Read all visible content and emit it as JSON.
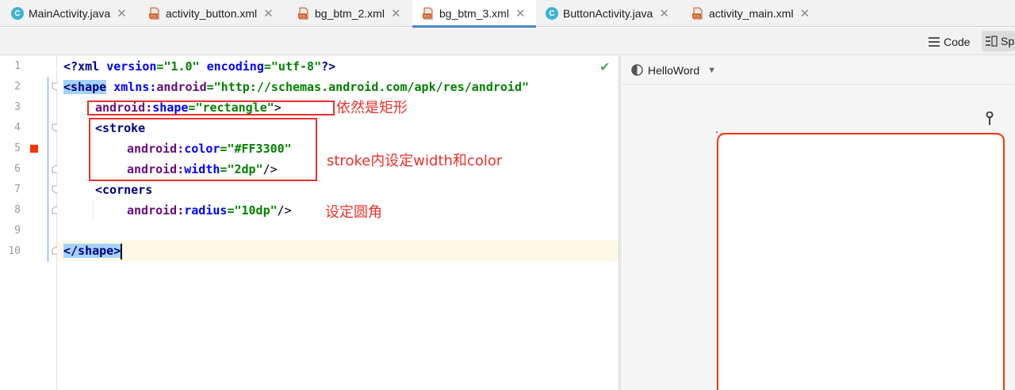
{
  "tabs": [
    {
      "label": "MainActivity.java",
      "type": "java",
      "active": false
    },
    {
      "label": "activity_button.xml",
      "type": "xml",
      "active": false
    },
    {
      "label": "bg_btm_2.xml",
      "type": "xml",
      "active": false
    },
    {
      "label": "bg_btm_3.xml",
      "type": "xml",
      "active": true
    },
    {
      "label": "ButtonActivity.java",
      "type": "java",
      "active": false
    },
    {
      "label": "activity_main.xml",
      "type": "xml",
      "active": false
    }
  ],
  "toolbar": {
    "code_label": "Code",
    "split_label": "Sp"
  },
  "editor": {
    "line_numbers": [
      "1",
      "2",
      "3",
      "4",
      "5",
      "6",
      "7",
      "8",
      "9",
      "10"
    ],
    "line1": {
      "t1": "<?",
      "t2": "xml ",
      "t3": "version",
      "t4": "=",
      "t5": "\"1.0\"",
      "t6": " encoding",
      "t7": "=",
      "t8": "\"utf-8\"",
      "t9": "?>"
    },
    "line2": {
      "t1": "<shape",
      "t2": " xmlns:",
      "t3": "android",
      "t4": "=",
      "t5": "\"http://schemas.android.com/apk/res/android\""
    },
    "line3": {
      "t1": "android:",
      "t2": "shape",
      "t3": "=",
      "t4": "\"rectangle\"",
      "t5": ">"
    },
    "line4": {
      "t1": "<stroke"
    },
    "line5": {
      "t1": "android:",
      "t2": "color",
      "t3": "=",
      "t4": "\"#FF3300\""
    },
    "line6": {
      "t1": "android:",
      "t2": "width",
      "t3": "=",
      "t4": "\"2dp\"",
      "t5": "/>"
    },
    "line7": {
      "t1": "<corners"
    },
    "line8": {
      "t1": "android:",
      "t2": "radius",
      "t3": "=",
      "t4": "\"10dp\"",
      "t5": "/>"
    },
    "line10": {
      "t1": "</shape>"
    }
  },
  "annotations": {
    "note1": "依然是矩形",
    "note2": "stroke内设定width和color",
    "note3": "设定圆角"
  },
  "preview": {
    "theme_label": "HelloWord"
  },
  "colors": {
    "annotation": "#e8322e",
    "stroke_preview": "#FF3300",
    "tab_accent": "#4a88c7"
  }
}
